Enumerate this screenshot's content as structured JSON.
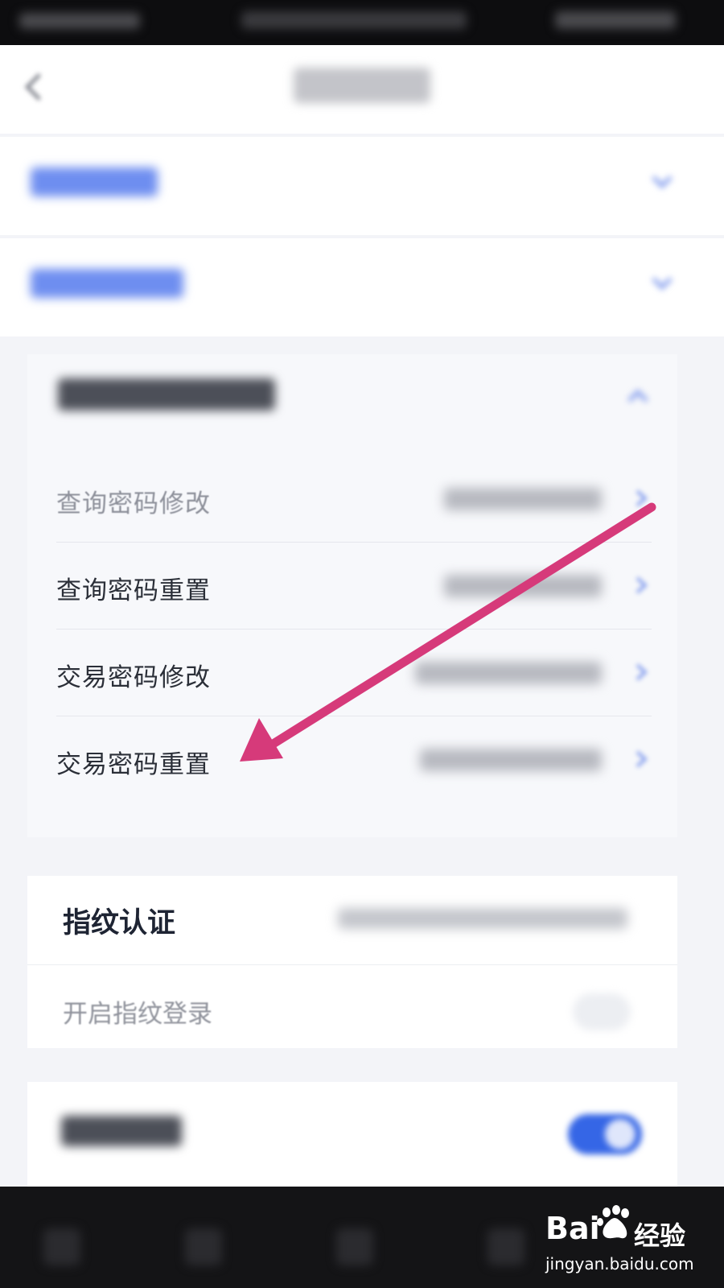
{
  "password_menu": {
    "items": [
      {
        "label": "查询密码修改"
      },
      {
        "label": "查询密码重置"
      },
      {
        "label": "交易密码修改"
      },
      {
        "label": "交易密码重置"
      }
    ]
  },
  "fingerprint": {
    "title": "指纹认证",
    "toggle_label": "开启指纹登录",
    "toggle_on": false
  },
  "face_auth": {
    "toggle_on": true
  },
  "colors": {
    "accent_blue": "#3566e6",
    "annotation_arrow": "#d63a7a"
  },
  "icons": {
    "back": "chevron-left-icon",
    "row_arrow": "chevron-right-icon",
    "expand": "chevron-down-icon"
  },
  "watermark": {
    "brand": "Bai",
    "brand_suffix": "经验",
    "url": "jingyan.baidu.com"
  }
}
